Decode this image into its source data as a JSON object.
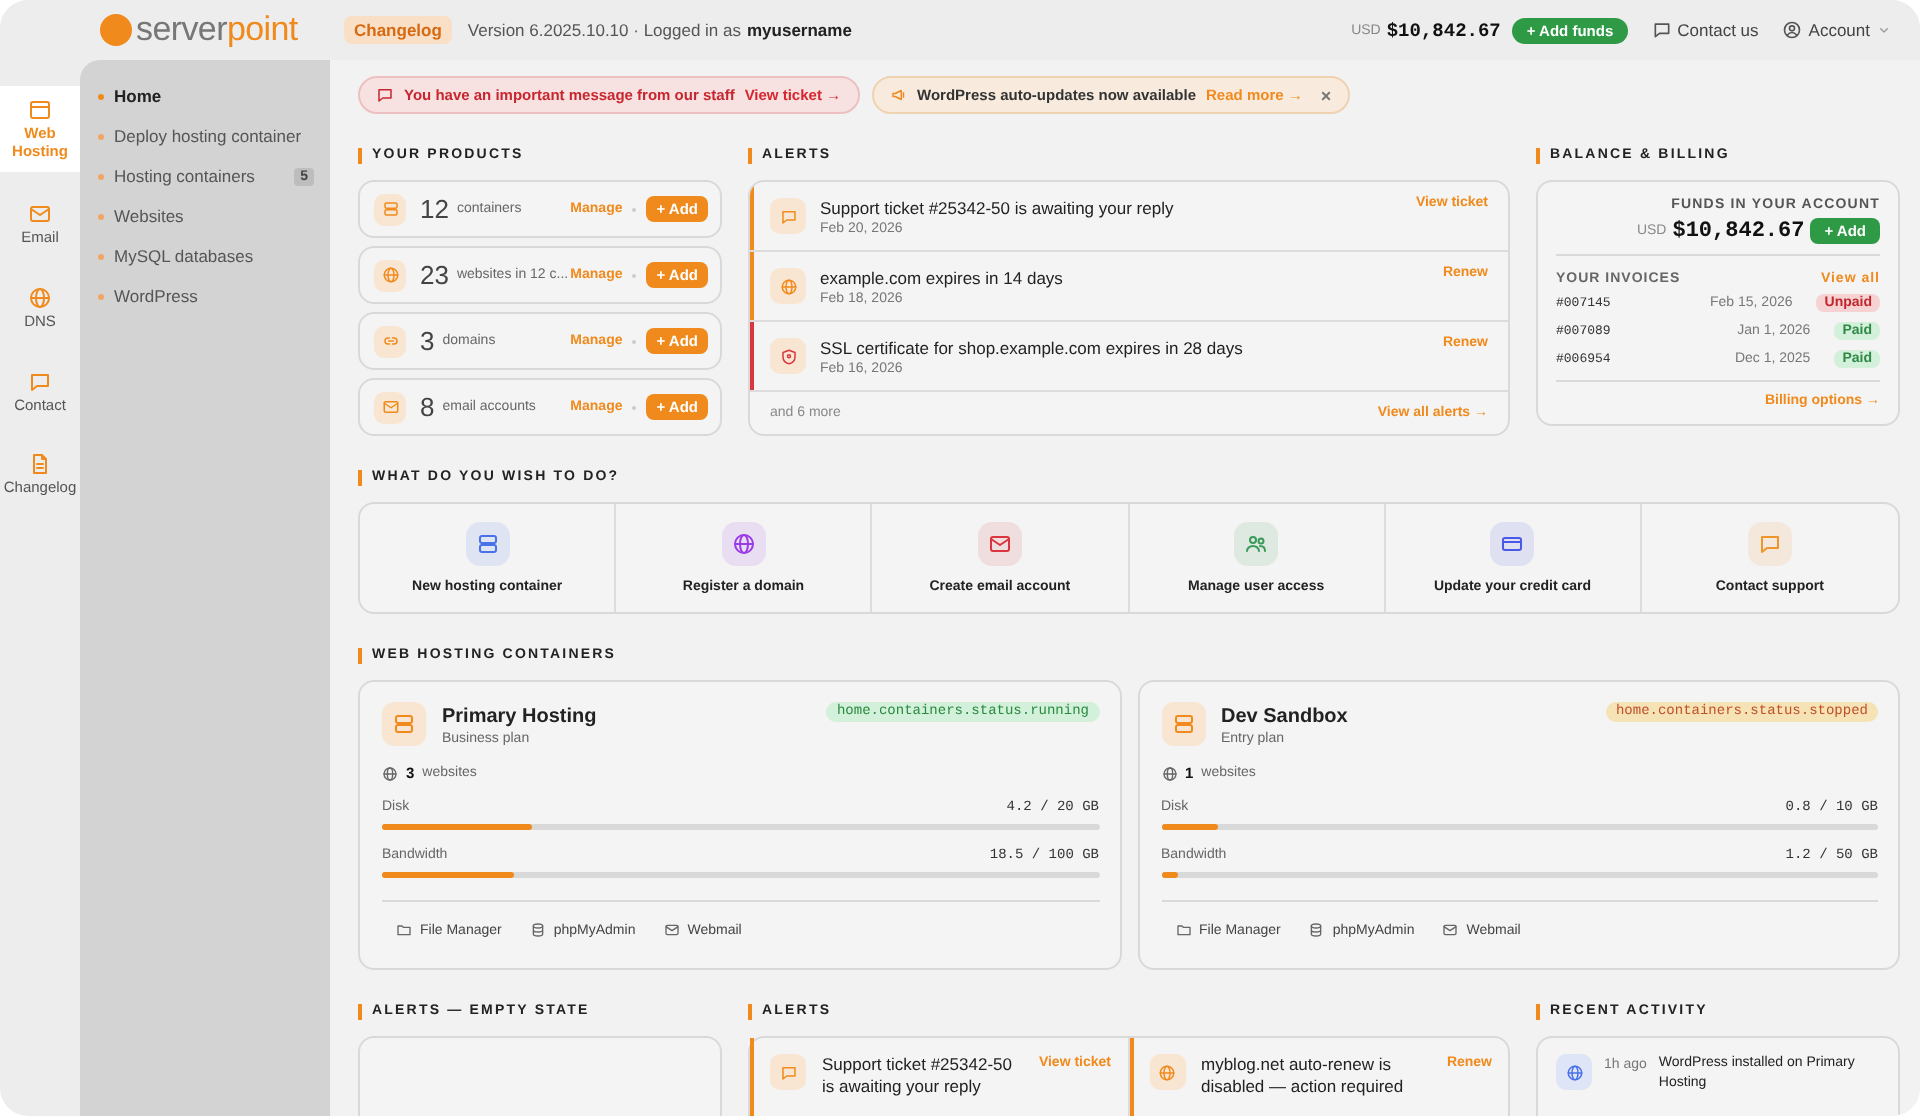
{
  "topbar": {
    "brand_first": "server",
    "brand_second": "point",
    "changelog": "Changelog",
    "version": "Version 6.2025.10.10 · Logged in as",
    "username": "myusername",
    "currency": "USD",
    "balance": "$10,842.67",
    "add_funds": "+ Add funds",
    "contact": "Contact us",
    "account": "Account"
  },
  "rail": [
    {
      "label": "Web Hosting",
      "kind": "browser",
      "selected": true
    },
    {
      "label": "Email",
      "kind": "mail",
      "selected": false
    },
    {
      "label": "DNS",
      "kind": "globe",
      "selected": false
    },
    {
      "label": "Contact",
      "kind": "chat",
      "selected": false
    },
    {
      "label": "Changelog",
      "kind": "doc",
      "selected": false
    }
  ],
  "submenu": [
    {
      "label": "Home",
      "selected": true
    },
    {
      "label": "Deploy hosting container",
      "selected": false
    },
    {
      "label": "Hosting containers",
      "badge": "5",
      "selected": false
    },
    {
      "label": "Websites",
      "selected": false
    },
    {
      "label": "MySQL databases",
      "selected": false
    },
    {
      "label": "WordPress",
      "selected": false
    }
  ],
  "notices": [
    {
      "kind": "staff",
      "text": "You have an important message from our staff",
      "link": "View ticket →"
    },
    {
      "kind": "update",
      "text": "WordPress auto-updates now available",
      "link": "Read more →",
      "close": "×"
    }
  ],
  "products": {
    "title": "YOUR PRODUCTS",
    "items": [
      {
        "kind": "server",
        "count": "12",
        "label": "containers",
        "manage": "Manage",
        "add": "+ Add"
      },
      {
        "kind": "globe",
        "count": "23",
        "label": "websites in 12 c...",
        "manage": "Manage",
        "add": "+ Add"
      },
      {
        "kind": "link",
        "count": "3",
        "label": "domains",
        "manage": "Manage",
        "add": "+ Add"
      },
      {
        "kind": "mail",
        "count": "8",
        "label": "email accounts",
        "manage": "Manage",
        "add": "+ Add"
      }
    ]
  },
  "alerts": {
    "title": "ALERTS",
    "items": [
      {
        "kind": "chat",
        "color": "#f08a1c",
        "title": "Support ticket #25342-50 is awaiting your reply",
        "date": "Feb 20, 2026",
        "action": "View ticket"
      },
      {
        "kind": "globe",
        "color": "#f08a1c",
        "title": "example.com expires in 14 days",
        "date": "Feb 18, 2026",
        "action": "Renew"
      },
      {
        "kind": "shield",
        "color": "#d9363e",
        "title": "SSL certificate for shop.example.com expires in 28 days",
        "date": "Feb 16, 2026",
        "action": "Renew"
      }
    ],
    "more": "and 6 more",
    "view_all": "View all alerts →"
  },
  "billing": {
    "title": "BALANCE & BILLING",
    "funds_label": "FUNDS IN YOUR ACCOUNT",
    "currency": "USD",
    "amount": "$10,842.67",
    "add": "+ Add",
    "invoices_label": "YOUR INVOICES",
    "view_all": "View all",
    "invoices": [
      {
        "number": "#007145",
        "date": "Feb 15, 2026",
        "status": "Unpaid",
        "kind": "unpaid"
      },
      {
        "number": "#007089",
        "date": "Jan 1, 2026",
        "status": "Paid",
        "kind": "paid"
      },
      {
        "number": "#006954",
        "date": "Dec 1, 2025",
        "status": "Paid",
        "kind": "paid"
      }
    ],
    "options": "Billing options →"
  },
  "actions": {
    "title": "WHAT DO YOU WISH TO DO?",
    "items": [
      {
        "kind": "server",
        "color": "#4a72e8",
        "label": "New hosting container"
      },
      {
        "kind": "globe",
        "color": "#9b3be8",
        "label": "Register a domain"
      },
      {
        "kind": "mail",
        "color": "#d9363e",
        "label": "Create email account"
      },
      {
        "kind": "users",
        "color": "#3a9a5a",
        "label": "Manage user access"
      },
      {
        "kind": "card",
        "color": "#4a5ae8",
        "label": "Update your credit card"
      },
      {
        "kind": "chat",
        "color": "#f0952a",
        "label": "Contact support"
      }
    ]
  },
  "containers": {
    "title": "WEB HOSTING CONTAINERS",
    "items": [
      {
        "name": "Primary Hosting",
        "plan": "Business plan",
        "status": "home.containers.status.running",
        "kind": "running",
        "sites_count": "3",
        "sites_label": "websites",
        "meters": [
          {
            "label": "Disk",
            "reading": "4.2 / 20 GB",
            "level": 0.21
          },
          {
            "label": "Bandwidth",
            "reading": "18.5 / 100 GB",
            "level": 0.185
          }
        ],
        "links": [
          {
            "kind": "folder",
            "label": "File Manager"
          },
          {
            "kind": "db",
            "label": "phpMyAdmin"
          },
          {
            "kind": "mail",
            "label": "Webmail"
          }
        ]
      },
      {
        "name": "Dev Sandbox",
        "plan": "Entry plan",
        "status": "home.containers.status.stopped",
        "kind": "stopped",
        "sites_count": "1",
        "sites_label": "websites",
        "meters": [
          {
            "label": "Disk",
            "reading": "0.8 / 10 GB",
            "level": 0.08
          },
          {
            "label": "Bandwidth",
            "reading": "1.2 / 50 GB",
            "level": 0.024
          }
        ],
        "links": [
          {
            "kind": "folder",
            "label": "File Manager"
          },
          {
            "kind": "db",
            "label": "phpMyAdmin"
          },
          {
            "kind": "mail",
            "label": "Webmail"
          }
        ]
      }
    ]
  },
  "empty_alerts": {
    "title": "ALERTS — EMPTY STATE"
  },
  "alerts_compact": {
    "title": "ALERTS",
    "items": [
      {
        "kind": "chat",
        "color": "#f08a1c",
        "title": "Support ticket #25342-50 is awaiting your reply",
        "action": "View ticket"
      },
      {
        "kind": "globe",
        "color": "#f08a1c",
        "title": "myblog.net auto-renew is disabled — action required",
        "action": "Renew"
      }
    ]
  },
  "activity": {
    "title": "RECENT ACTIVITY",
    "items": [
      {
        "kind": "globe",
        "time": "1h ago",
        "text": "WordPress installed on Primary Hosting"
      }
    ]
  }
}
